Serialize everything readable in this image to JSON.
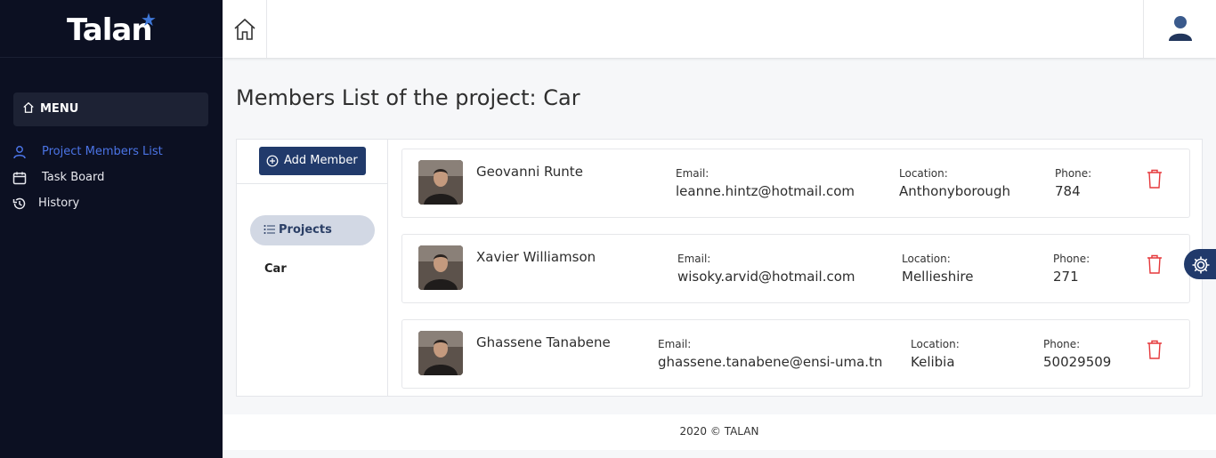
{
  "brand": {
    "name": "Talan",
    "star_color": "#3e77d8"
  },
  "sidebar": {
    "menu_label": "MENU",
    "items": [
      {
        "label": "Project Members List",
        "icon": "user-icon",
        "active": true
      },
      {
        "label": "Task Board",
        "icon": "calendar-icon",
        "active": false
      },
      {
        "label": "History",
        "icon": "history-icon",
        "active": false
      }
    ]
  },
  "header": {
    "home_icon": "home-icon",
    "avatar_icon": "user-avatar-icon"
  },
  "page": {
    "title": "Members List of the project: Car"
  },
  "actions": {
    "add_member_label": "Add Member"
  },
  "projects": {
    "heading": "Projects",
    "items": [
      "Car"
    ]
  },
  "members": [
    {
      "name": "Geovanni Runte",
      "email_label": "Email:",
      "email": "leanne.hintz@hotmail.com",
      "location_label": "Location:",
      "location": "Anthonyborough",
      "phone_label": "Phone:",
      "phone": "784"
    },
    {
      "name": "Xavier Williamson",
      "email_label": "Email:",
      "email": "wisoky.arvid@hotmail.com",
      "location_label": "Location:",
      "location": "Mellieshire",
      "phone_label": "Phone:",
      "phone": "271"
    },
    {
      "name": "Ghassene Tanabene",
      "email_label": "Email:",
      "email": "ghassene.tanabene@ensi-uma.tn",
      "location_label": "Location:",
      "location": "Kelibia",
      "phone_label": "Phone:",
      "phone": "50029509"
    }
  ],
  "footer": {
    "text": "2020 © TALAN"
  },
  "colors": {
    "sidebar_bg": "#0c1022",
    "primary": "#213a6b",
    "active_link": "#4b74e6",
    "danger": "#e5383b"
  }
}
